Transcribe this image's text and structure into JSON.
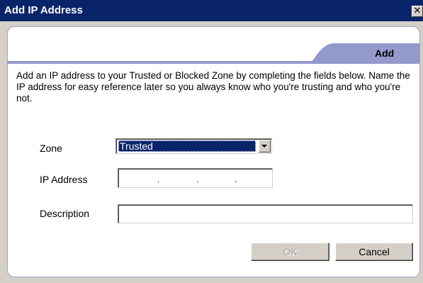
{
  "window": {
    "title": "Add IP Address",
    "close_glyph": "✕"
  },
  "tabs": [
    {
      "label": "Add",
      "active": true
    }
  ],
  "intro_text": "Add an IP address to your Trusted or Blocked Zone by completing the fields below.  Name the IP address for easy reference later so you always know who you're trusting and who you're not.",
  "form": {
    "zone": {
      "label": "Zone",
      "value": "Trusted"
    },
    "ip_address": {
      "label": "IP Address",
      "value": ""
    },
    "description": {
      "label": "Description",
      "value": ""
    }
  },
  "buttons": {
    "ok": {
      "label": "OK",
      "enabled": false
    },
    "cancel": {
      "label": "Cancel",
      "enabled": true
    }
  },
  "colors": {
    "titlebar": "#0a246a",
    "tab": "#9499cb",
    "dialog_face": "#d4d0c8",
    "selection": "#0a246a"
  },
  "icons": {
    "close": "close-icon",
    "dropdown": "chevron-down-icon"
  }
}
